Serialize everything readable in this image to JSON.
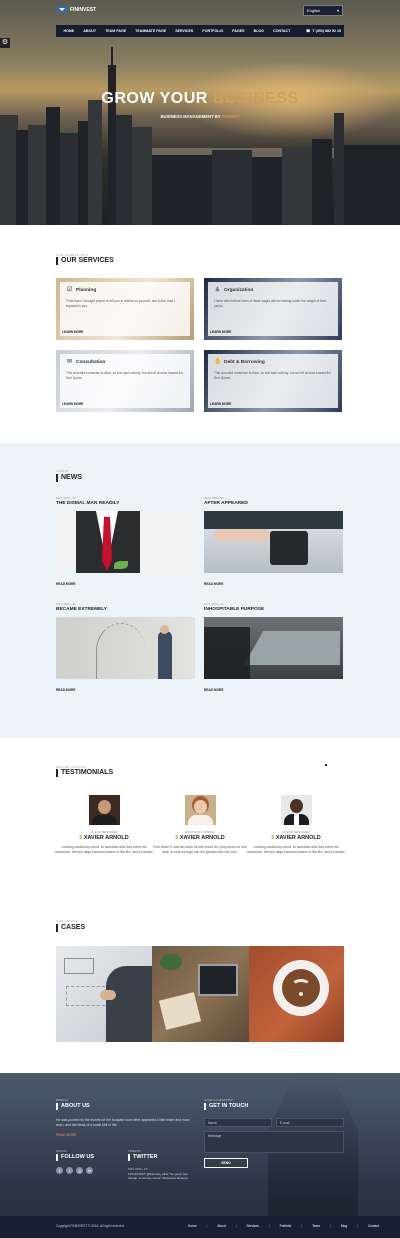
{
  "header": {
    "logo_text": "FININVEST",
    "language": "English",
    "nav": [
      "HOME",
      "ABOUT",
      "TEAM PAGE",
      "TEAMMATE PAGE",
      "SERVICES",
      "PORTFOLIO",
      "PAGES",
      "BLOG",
      "CONTACT"
    ],
    "phone": "T (450) 882 92 15"
  },
  "hero": {
    "title_main": "GROW YOUR ",
    "title_highlight": "BUSINESS",
    "subtitle_main": "BUSINESS MANAGEMENT BY ",
    "subtitle_highlight": "FINVEST"
  },
  "services": {
    "kicker": "OUR HUMBLE TEXT",
    "heading": "OUR SERVICES",
    "items": [
      {
        "title": "Planning",
        "text": "Thus much I thought proper to tell you in relation to yourself, and to the trust I reposed in you.",
        "more": "LEARN MORE"
      },
      {
        "title": "Organization",
        "text": "I have often before been of those sages almost sinking under the weight of their packs.",
        "more": "LEARN MORE"
      },
      {
        "title": "Consultation",
        "text": "This sounded nonsense to Alice, so she said nothing, but set off at once toward the Red Queen.",
        "more": "LEARN MORE"
      },
      {
        "title": "Debt & Borrowing",
        "text": "This sounded nonsense to Alice, so she said nothing, but set off at once toward the Red Queen.",
        "more": "LEARN MORE"
      }
    ]
  },
  "news": {
    "kicker": "LATEST",
    "heading": "NEWS",
    "items": [
      {
        "date": "DEC 30TH, 30",
        "title": "THE DISMAL MAN READILY",
        "more": "READ MORE"
      },
      {
        "date": "NOV 30TH, 30",
        "title": "AFTER APPEARED",
        "more": "READ MORE"
      },
      {
        "date": "NOV 30TH, 30",
        "title": "BECAME EXTREMELY",
        "more": "READ MORE"
      },
      {
        "date": "OCT 30TH, 30",
        "title": "INHOSPITABLE PURPOSE",
        "more": "READ MORE"
      }
    ]
  },
  "testimonials": {
    "kicker": "WE ARE TRUSTED",
    "heading": "TESTIMONIALS",
    "items": [
      {
        "role": "UI & UX DESIGNER",
        "name": "XAVIER ARNOLD",
        "text": "Looking cautiously round, to ascertain that they were not overheard, the two hags cowered nearer to the fire, and chuckled."
      },
      {
        "role": "AUSTIN FIN CONSUL",
        "name": "XAVIER ARNOLD",
        "text": "Poor Alice! It was as much as she could do, lying down on one side, to look through into the garden with one eye."
      },
      {
        "role": "UI & UX DESIGNER",
        "name": "XAVIER ARNOLD",
        "text": "Looking cautiously round, to ascertain that they were not overheard, the two hags cowered nearer to the fire, and chuckled."
      }
    ]
  },
  "cases": {
    "kicker": "OUR LATEST",
    "heading": "CASES"
  },
  "footer": {
    "about_kicker": "BRIEFLY",
    "about_heading": "ABOUT US",
    "about_text": "He was pushed by the events for the footpath soon after appeared a little wider and more worn, and the bleak of a small bell in the.",
    "about_more": "READ MORE",
    "follow_kicker": "SOCIAL",
    "follow_heading": "FOLLOW US",
    "social": [
      "f",
      "t",
      "g",
      "in"
    ],
    "twitter_kicker": "TWEETS",
    "twitter_heading": "TWITTER",
    "tweet_date": "MAY 30TH, 15",
    "tweet_text": "FINVINVEST @fininvest_elise \"So good, few though, to convey sense\" #business #finance",
    "contact_kicker": "HAVE A QUESTION?",
    "contact_heading": "GET IN TOUCH",
    "name_placeholder": "Name",
    "email_placeholder": "E-mail",
    "message_placeholder": "Message",
    "send": "SEND",
    "copyright": "Copyright FININVEST © 2016. All right reserved",
    "links": [
      "Home",
      "About",
      "Services",
      "Portfolio",
      "Team",
      "Blog",
      "Contact"
    ]
  },
  "colors": {
    "accent": "#cf9e58",
    "nav": "#151d2e",
    "news_bg": "#ebf3f8",
    "footer_bottom": "#182133"
  }
}
